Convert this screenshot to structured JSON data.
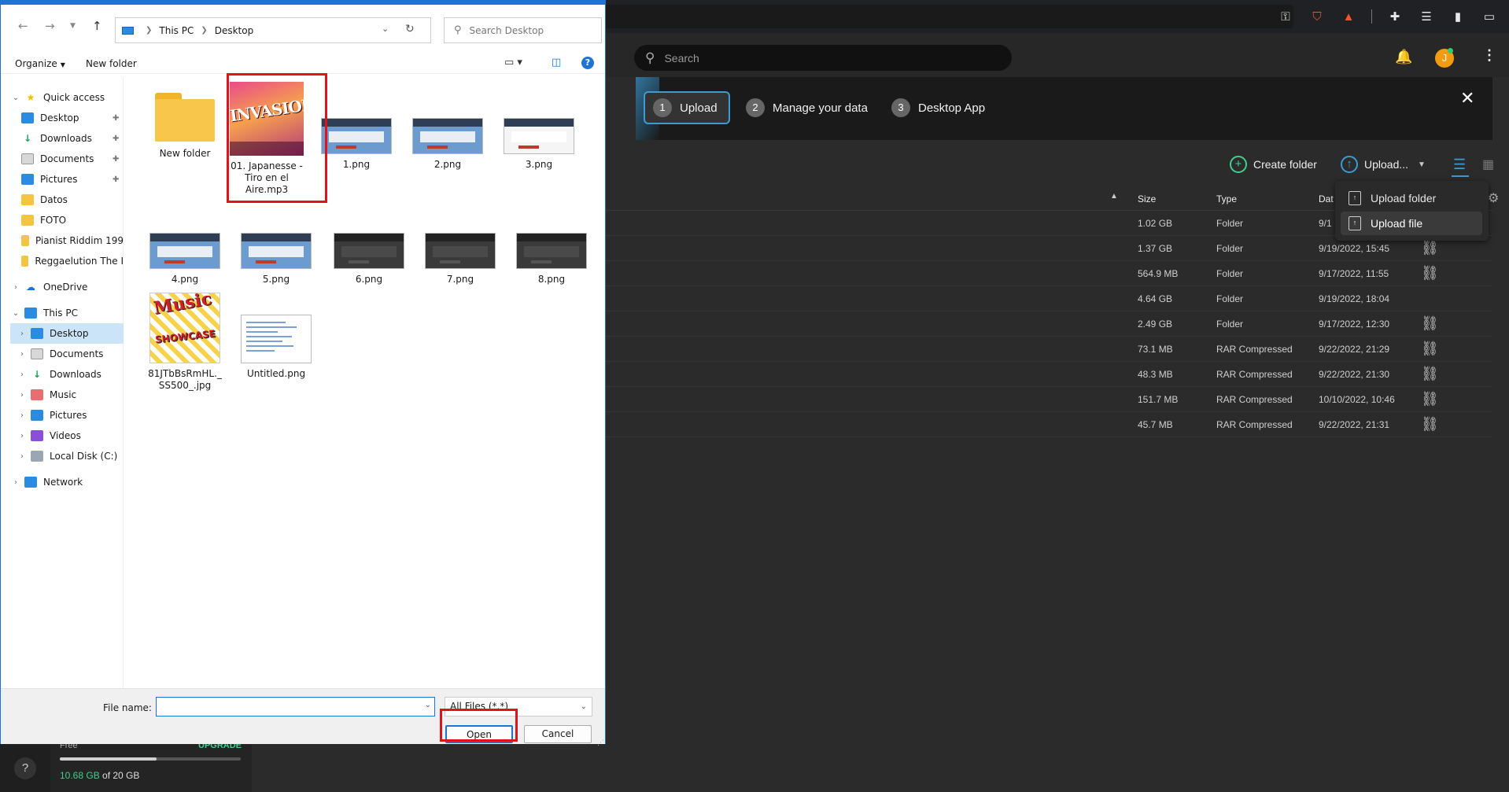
{
  "background_app": {
    "search_placeholder": "Search",
    "avatar_initial": "J",
    "onboarding": {
      "steps": [
        {
          "number": "1",
          "label": "Upload"
        },
        {
          "number": "2",
          "label": "Manage your data"
        },
        {
          "number": "3",
          "label": "Desktop App"
        }
      ],
      "close": "✕"
    },
    "toolbar": {
      "create_folder": "Create folder",
      "upload": "Upload..."
    },
    "upload_menu": {
      "folder": "Upload folder",
      "file": "Upload file"
    },
    "columns": {
      "size": "Size",
      "type": "Type",
      "date": "Dat"
    },
    "rows": [
      {
        "size": "1.02 GB",
        "type": "Folder",
        "date": "9/1",
        "link": ""
      },
      {
        "size": "1.37 GB",
        "type": "Folder",
        "date": "9/19/2022, 15:45",
        "link": "⛓"
      },
      {
        "size": "564.9 MB",
        "type": "Folder",
        "date": "9/17/2022, 11:55",
        "link": "⛓"
      },
      {
        "size": "4.64 GB",
        "type": "Folder",
        "date": "9/19/2022, 18:04",
        "link": ""
      },
      {
        "size": "2.49 GB",
        "type": "Folder",
        "date": "9/17/2022, 12:30",
        "link": "⛓"
      },
      {
        "size": "73.1 MB",
        "type": "RAR Compressed",
        "date": "9/22/2022, 21:29",
        "link": "⛓"
      },
      {
        "size": "48.3 MB",
        "type": "RAR Compressed",
        "date": "9/22/2022, 21:30",
        "link": "⛓"
      },
      {
        "size": "151.7 MB",
        "type": "RAR Compressed",
        "date": "10/10/2022, 10:46",
        "link": "⛓"
      },
      {
        "size": "45.7 MB",
        "type": "RAR Compressed",
        "date": "9/22/2022, 21:31",
        "link": "⛓"
      }
    ],
    "storage": {
      "plan": "Free",
      "upgrade": "UPGRADE",
      "used": "10.68 GB",
      "of_total": " of 20 GB",
      "fraction": 0.534
    },
    "colors": {
      "accent": "#3a9bd5",
      "green": "#3ecf8e"
    }
  },
  "dialog": {
    "breadcrumb": [
      "This PC",
      "Desktop"
    ],
    "search_placeholder": "Search Desktop",
    "commands": {
      "organize": "Organize",
      "new_folder": "New folder"
    },
    "nav": {
      "quick_access": "Quick access",
      "quick_items": [
        "Desktop",
        "Downloads",
        "Documents",
        "Pictures",
        "Datos",
        "FOTO",
        "Pianist Riddim 199",
        "Reggaelution The I"
      ],
      "onedrive": "OneDrive",
      "this_pc": "This PC",
      "pc_items": [
        "Desktop",
        "Documents",
        "Downloads",
        "Music",
        "Pictures",
        "Videos",
        "Local Disk (C:)"
      ],
      "network": "Network"
    },
    "files": [
      {
        "name": "New folder"
      },
      {
        "name": "01. Japanesse - Tiro en el Aire.mp3",
        "cover_title": "INVASION"
      },
      {
        "name": "1.png"
      },
      {
        "name": "2.png"
      },
      {
        "name": "3.png"
      },
      {
        "name": "4.png"
      },
      {
        "name": "5.png"
      },
      {
        "name": "6.png"
      },
      {
        "name": "7.png"
      },
      {
        "name": "8.png"
      },
      {
        "name": "81JTbBsRmHL._SS500_.jpg"
      },
      {
        "name": "Untitled.png"
      }
    ],
    "file_name_label": "File name:",
    "file_name_value": "",
    "filter": "All Files (*.*)",
    "open": "Open",
    "cancel": "Cancel",
    "colors": {
      "highlight": "#e0121c",
      "accent": "#1e74d4"
    }
  }
}
